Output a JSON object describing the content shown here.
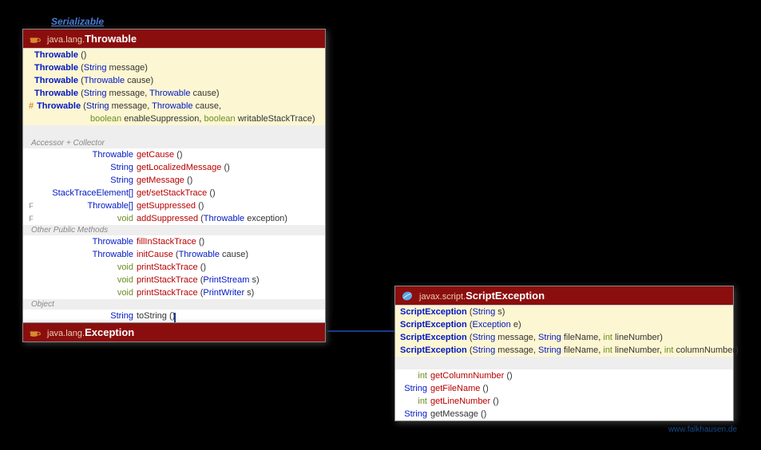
{
  "interface": "Serializable",
  "throwable": {
    "pkg": "java.lang.",
    "name": "Throwable",
    "constructors": [
      {
        "name": "Throwable",
        "params": "()"
      },
      {
        "name": "Throwable",
        "params": "(String message)"
      },
      {
        "name": "Throwable",
        "params": "(Throwable cause)"
      },
      {
        "name": "Throwable",
        "params": "(String message, Throwable cause)"
      },
      {
        "mod": "#",
        "name": "Throwable",
        "params_l1": "(String message, Throwable cause,",
        "params_l2": "boolean enableSuppression, boolean writableStackTrace)"
      }
    ],
    "sections": {
      "accessor": "Accessor + Collector",
      "other": "Other Public Methods",
      "object": "Object"
    },
    "accessor_methods": [
      {
        "ret": "Throwable",
        "name": "getCause",
        "params": "()"
      },
      {
        "ret": "String",
        "name": "getLocalizedMessage",
        "params": "()"
      },
      {
        "ret": "String",
        "name": "getMessage",
        "params": "()"
      },
      {
        "ret": "StackTraceElement[]",
        "name": "get/setStackTrace",
        "params": "()"
      },
      {
        "mod": "F",
        "ret": "Throwable[]",
        "name": "getSuppressed",
        "params": "()"
      },
      {
        "mod": "F",
        "ret": "void",
        "name": "addSuppressed",
        "params": "(Throwable exception)"
      }
    ],
    "other_methods": [
      {
        "ret": "Throwable",
        "name": "fillInStackTrace",
        "params": "()"
      },
      {
        "ret": "Throwable",
        "name": "initCause",
        "params": "(Throwable cause)"
      },
      {
        "ret": "void",
        "name": "printStackTrace",
        "params": "()"
      },
      {
        "ret": "void",
        "name": "printStackTrace",
        "params": "(PrintStream s)"
      },
      {
        "ret": "void",
        "name": "printStackTrace",
        "params": "(PrintWriter s)"
      }
    ],
    "object_methods": [
      {
        "ret": "String",
        "name": "toString",
        "params": "()"
      }
    ]
  },
  "exception": {
    "pkg": "java.lang.",
    "name": "Exception"
  },
  "scriptexception": {
    "pkg": "javax.script.",
    "name": "ScriptException",
    "constructors": [
      {
        "name": "ScriptException",
        "params": "(String s)"
      },
      {
        "name": "ScriptException",
        "params": "(Exception e)"
      },
      {
        "name": "ScriptException",
        "params": "(String message, String fileName, int lineNumber)"
      },
      {
        "name": "ScriptException",
        "params": "(String message, String fileName, int lineNumber, int columnNumber)"
      }
    ],
    "methods": [
      {
        "ret": "int",
        "name": "getColumnNumber",
        "params": "()",
        "color": "method"
      },
      {
        "ret": "String",
        "name": "getFileName",
        "params": "()",
        "color": "method"
      },
      {
        "ret": "int",
        "name": "getLineNumber",
        "params": "()",
        "color": "method"
      },
      {
        "ret": "String",
        "name": "getMessage",
        "params": "()",
        "color": "plain"
      }
    ]
  },
  "watermark": "www.falkhausen.de"
}
